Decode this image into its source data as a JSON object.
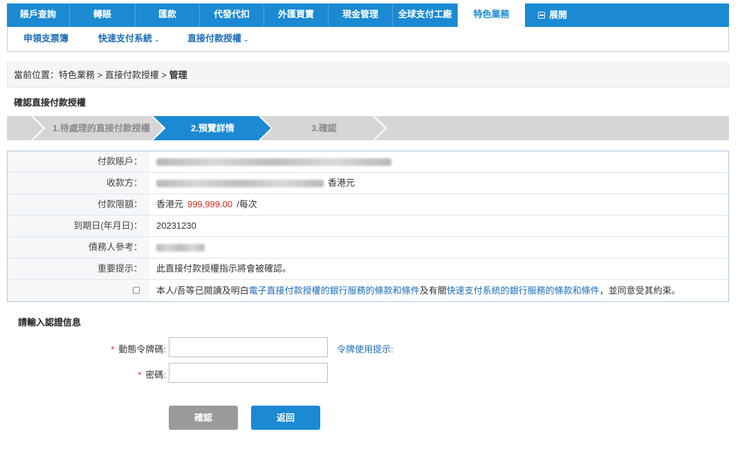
{
  "topnav": {
    "tabs": [
      {
        "label": "賬戶查詢"
      },
      {
        "label": "轉賬"
      },
      {
        "label": "匯款"
      },
      {
        "label": "代發代扣"
      },
      {
        "label": "外匯買賣"
      },
      {
        "label": "現金管理"
      },
      {
        "label": "全球支付工廠"
      },
      {
        "label": "特色業務"
      }
    ],
    "expand_label": "展開",
    "active_index": 7
  },
  "subnav": {
    "items": [
      {
        "label": "申領支票簿"
      },
      {
        "label": "快速支付系統"
      },
      {
        "label": "直接付款授權"
      }
    ]
  },
  "breadcrumb": {
    "prefix": "當前位置：特色業務 > 直接付款授權 > ",
    "current": "管理"
  },
  "section_title": "確認直接付款授權",
  "steps": [
    {
      "label": "1.待處理的直接付款授權"
    },
    {
      "label": "2.預覽詳情"
    },
    {
      "label": "3.確認"
    }
  ],
  "steps_active_index": 1,
  "details": {
    "payer_label": "付款賬戶：",
    "payee_label": "收款方：",
    "payee_currency": "香港元",
    "limit_label": "付款限額：",
    "limit_currency": "香港元",
    "limit_amount": "999,999.00",
    "limit_unit": "/每次",
    "expiry_label": "到期日(年月日)：",
    "expiry_value": "20231230",
    "debtor_ref_label": "債務人參考：",
    "notice_label": "重要提示：",
    "notice_text": "此直接付款授權指示將會被確認。",
    "terms_prefix": "本人/吾等已閱讀及明白",
    "terms_link1": "電子直接付款授權的銀行服務的條款和條件",
    "terms_middle": "及有關",
    "terms_link2": "快速支付系統的銀行服務的條款和條件",
    "terms_suffix": "，並同意受其約束。"
  },
  "auth": {
    "title": "請輸入認證信息",
    "token_label": "動態令牌碼:",
    "password_label": "密碼:",
    "required_mark": "*",
    "token_hint": "令牌使用提示:"
  },
  "buttons": {
    "confirm": "確認",
    "back": "返回"
  },
  "colors": {
    "primary": "#1b8ad3",
    "alert": "#d9261c",
    "step_inactive": "#d6d6d6"
  }
}
